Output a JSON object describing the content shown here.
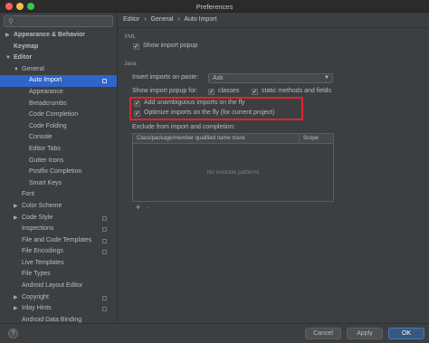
{
  "window": {
    "title": "Preferences"
  },
  "sidebar": {
    "search_placeholder": "",
    "items": [
      {
        "label": "Appearance & Behavior",
        "bold": true
      },
      {
        "label": "Keymap",
        "bold": true
      },
      {
        "label": "Editor",
        "bold": true
      },
      {
        "label": "General"
      },
      {
        "label": "Auto Import",
        "selected": true
      },
      {
        "label": "Appearance"
      },
      {
        "label": "Breadcrumbs"
      },
      {
        "label": "Code Completion"
      },
      {
        "label": "Code Folding"
      },
      {
        "label": "Console"
      },
      {
        "label": "Editor Tabs"
      },
      {
        "label": "Gutter Icons"
      },
      {
        "label": "Postfix Completion"
      },
      {
        "label": "Smart Keys"
      },
      {
        "label": "Font"
      },
      {
        "label": "Color Scheme"
      },
      {
        "label": "Code Style"
      },
      {
        "label": "Inspections"
      },
      {
        "label": "File and Code Templates"
      },
      {
        "label": "File Encodings"
      },
      {
        "label": "Live Templates"
      },
      {
        "label": "File Types"
      },
      {
        "label": "Android Layout Editor"
      },
      {
        "label": "Copyright"
      },
      {
        "label": "Inlay Hints"
      },
      {
        "label": "Android Data Binding"
      }
    ]
  },
  "breadcrumb": {
    "part1": "Editor",
    "sep1": "›",
    "part2": "General",
    "sep2": "›",
    "part3": "Auto Import"
  },
  "xml": {
    "section": "XML",
    "show_import_popup": {
      "label": "Show import popup",
      "checked": true
    }
  },
  "java": {
    "section": "Java",
    "insert_on_paste_label": "Insert imports on paste:",
    "insert_on_paste_value": "Ask",
    "show_popup_for_label": "Show import popup for:",
    "classes": {
      "label": "classes",
      "checked": true
    },
    "static_methods": {
      "label": "static methods and fields",
      "checked": true
    },
    "add_unambiguous": {
      "label": "Add unambiguous imports on the fly",
      "checked": true
    },
    "optimize_imports": {
      "label": "Optimize imports on the fly (for current project)",
      "checked": true
    },
    "exclude_label": "Exclude from import and completion:",
    "table": {
      "col_class": "Class/package/member qualified name mask",
      "col_scope": "Scope",
      "empty_text": "No exclude patterns"
    },
    "add_btn": "+",
    "remove_btn": "−"
  },
  "buttons": {
    "help": "?",
    "cancel": "Cancel",
    "apply": "Apply",
    "ok": "OK"
  },
  "colors": {
    "selection": "#2f65ca",
    "highlight_box": "#e0252b",
    "ok_button": "#365880"
  }
}
